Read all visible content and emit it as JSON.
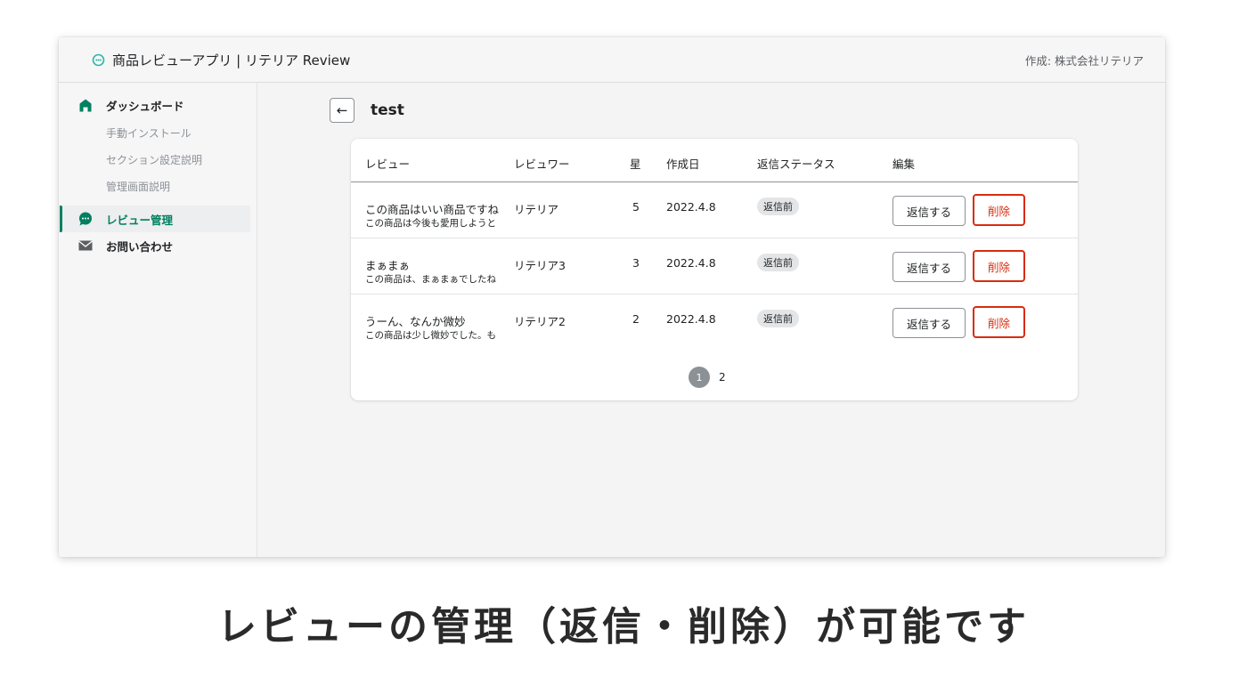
{
  "app": {
    "title": "商品レビューアプリ | リテリア Review",
    "created_by": "作成: 株式会社リテリア"
  },
  "sidebar": {
    "items": [
      {
        "label": "ダッシュボード",
        "icon": "home-icon"
      },
      {
        "label": "手動インストール"
      },
      {
        "label": "セクション設定説明"
      },
      {
        "label": "管理画面説明"
      },
      {
        "label": "レビュー管理",
        "icon": "chat-icon"
      },
      {
        "label": "お問い合わせ",
        "icon": "mail-icon"
      }
    ]
  },
  "page": {
    "back_icon": "←",
    "title": "test"
  },
  "table": {
    "headers": [
      "レビュー",
      "レビュワー",
      "星",
      "作成日",
      "返信ステータス",
      "編集"
    ],
    "rows": [
      {
        "title": "この商品はいい商品ですね",
        "body": "この商品は今後も愛用しようと",
        "reviewer": "リテリア",
        "stars": "5",
        "date": "2022.4.8",
        "status": "返信前",
        "reply": "返信する",
        "delete": "削除"
      },
      {
        "title": "まぁまぁ",
        "body": "この商品は、まぁまぁでしたね",
        "reviewer": "リテリア3",
        "stars": "3",
        "date": "2022.4.8",
        "status": "返信前",
        "reply": "返信する",
        "delete": "削除"
      },
      {
        "title": "うーん、なんか微妙",
        "body": "この商品は少し微妙でした。も",
        "reviewer": "リテリア2",
        "stars": "2",
        "date": "2022.4.8",
        "status": "返信前",
        "reply": "返信する",
        "delete": "削除"
      }
    ]
  },
  "pagination": {
    "current": "1",
    "next": "2"
  },
  "caption": "レビューの管理（返信・削除）が可能です",
  "colors": {
    "accent": "#008060",
    "danger": "#d82c0d"
  }
}
